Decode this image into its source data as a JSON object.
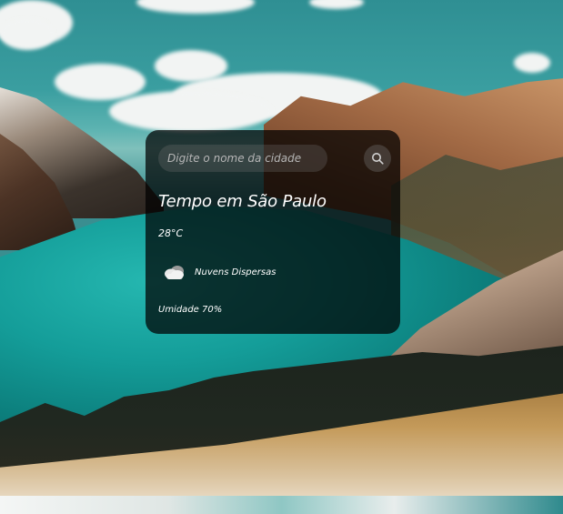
{
  "search": {
    "placeholder": "Digite o nome da cidade",
    "button_icon": "search-icon"
  },
  "weather": {
    "title": "Tempo em São Paulo",
    "temperature": "28°C",
    "icon": "cloud-icon",
    "description": "Nuvens Dispersas",
    "humidity": "Umidade 70%"
  },
  "colors": {
    "card_background": "rgba(0,0,0,0.72)",
    "text": "#ffffff"
  }
}
